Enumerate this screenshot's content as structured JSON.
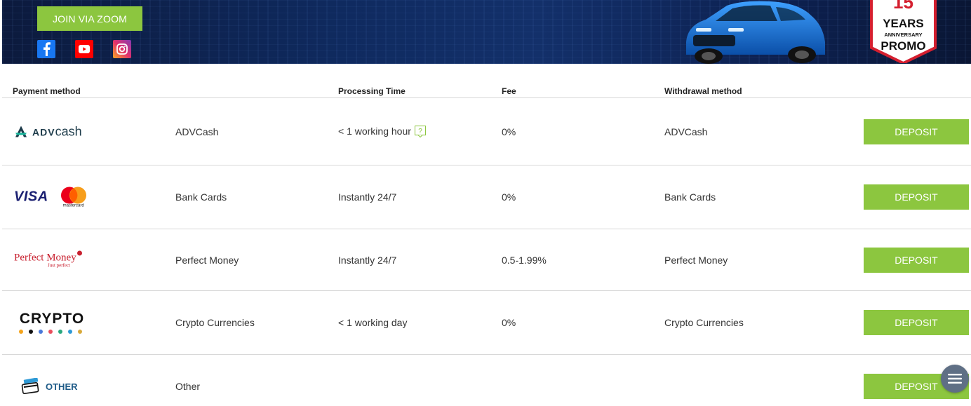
{
  "banner": {
    "zoom_button": "JOIN VIA ZOOM",
    "social": [
      "facebook-icon",
      "youtube-icon",
      "instagram-icon"
    ],
    "promo": {
      "years": "15",
      "line1": "YEARS",
      "line2": "ANNIVERSARY",
      "line3": "PROMO"
    }
  },
  "table": {
    "headers": {
      "payment_method": "Payment method",
      "processing_time": "Processing Time",
      "fee": "Fee",
      "withdrawal_method": "Withdrawal method"
    },
    "rows": [
      {
        "logo_text": "ADVcash",
        "name": "ADVCash",
        "time": "< 1 working hour",
        "fee": "0%",
        "withdrawal": "ADVCash",
        "action": "DEPOSIT"
      },
      {
        "logo_text": "VISA",
        "logo_sub": "mastercard",
        "name": "Bank Cards",
        "time": "Instantly 24/7",
        "fee": "0%",
        "withdrawal": "Bank Cards",
        "action": "DEPOSIT"
      },
      {
        "logo_text": "Perfect Money",
        "logo_sub": "Just perfect",
        "name": "Perfect Money",
        "time": "Instantly 24/7",
        "fee": "0.5-1.99%",
        "withdrawal": "Perfect Money",
        "action": "DEPOSIT"
      },
      {
        "logo_text": "CRYPTO",
        "name": "Crypto Currencies",
        "time": "< 1 working day",
        "fee": "0%",
        "withdrawal": "Crypto Currencies",
        "action": "DEPOSIT"
      },
      {
        "logo_text": "OTHER",
        "name": "Other",
        "time": "",
        "fee": "",
        "withdrawal": "",
        "action": "DEPOSIT"
      }
    ]
  },
  "colors": {
    "accent": "#8cc63f",
    "banner": "#0f2a5f",
    "divider": "#d8d8d8"
  }
}
